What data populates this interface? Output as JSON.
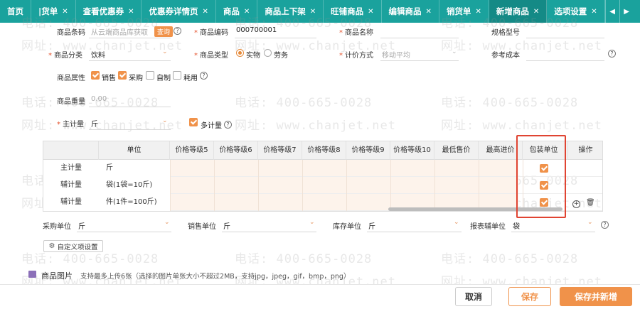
{
  "tabs": [
    {
      "label": "首页",
      "closable": false
    },
    {
      "label": "|货单",
      "closable": true
    },
    {
      "label": "查看优惠券",
      "closable": true
    },
    {
      "label": "优惠券详情页",
      "closable": true
    },
    {
      "label": "商品",
      "closable": true
    },
    {
      "label": "商品上下架",
      "closable": true
    },
    {
      "label": "旺铺商品",
      "closable": true
    },
    {
      "label": "编辑商品",
      "closable": true
    },
    {
      "label": "销货单",
      "closable": true
    },
    {
      "label": "新增商品",
      "closable": true,
      "active": true
    },
    {
      "label": "选项设置",
      "closable": true
    }
  ],
  "tab_close_glyph": "✕",
  "tab_scroll": {
    "left": "◀",
    "right": "▶"
  },
  "form": {
    "barcode_label": "商品条码",
    "barcode_placeholder": "从云端商品库获取",
    "query_button": "查询",
    "code_label": "商品编码",
    "code_value": "000700001",
    "name_label": "商品名称",
    "spec_label": "规格型号",
    "category_label": "商品分类",
    "category_value": "饮料",
    "type_label": "商品类型",
    "type_option_1": "实物",
    "type_option_2": "劳务",
    "pricing_label": "计价方式",
    "pricing_value": "移动平均",
    "ref_cost_label": "参考成本",
    "attr_label": "商品属性",
    "attr_sale": "销售",
    "attr_purchase": "采购",
    "attr_self": "自制",
    "attr_consume": "耗用",
    "weight_label": "商品重量",
    "weight_placeholder": "0.00",
    "main_unit_label": "主计量",
    "main_unit_value": "斤",
    "multi_unit_label": "多计量",
    "required_mark": "*",
    "help_mark": "?"
  },
  "grid": {
    "fixed_headers": [
      "",
      "单位"
    ],
    "scroll_headers": [
      "价格等级5",
      "价格等级6",
      "价格等级7",
      "价格等级8",
      "价格等级9",
      "价格等级10",
      "最低售价",
      "最高进价"
    ],
    "pack_header": "包装单位",
    "op_header": "操作",
    "rows": [
      {
        "type": "主计量",
        "unit": "斤",
        "pack": true
      },
      {
        "type": "辅计量",
        "unit": "袋(1袋=10斤)",
        "pack": true
      },
      {
        "type": "辅计量",
        "unit": "件(1件=100斤)",
        "pack": true
      }
    ],
    "add_glyph": "+",
    "delete_glyph": "🗑"
  },
  "units": {
    "purchase_label": "采购单位",
    "purchase_value": "斤",
    "sales_label": "销售单位",
    "sales_value": "斤",
    "stock_label": "库存单位",
    "stock_value": "斤",
    "report_label": "报表辅单位",
    "report_value": "袋"
  },
  "custom_button": "自定义项设置",
  "image_section": {
    "label": "商品图片",
    "hint": "支持最多上传6张（选择的图片单张大小不超过2MB，支持jpg，jpeg，gif，bmp，png）"
  },
  "footer": {
    "cancel": "取消",
    "save": "保存",
    "save_new": "保存并新增"
  },
  "watermark": {
    "phone": "电话: 400-665-0028",
    "site": "网址: www.chanjet.net"
  },
  "colors": {
    "tab_bg": "#1aa29d",
    "accent": "#f0924a",
    "required": "#e5532d",
    "highlight_box": "#e04432"
  }
}
